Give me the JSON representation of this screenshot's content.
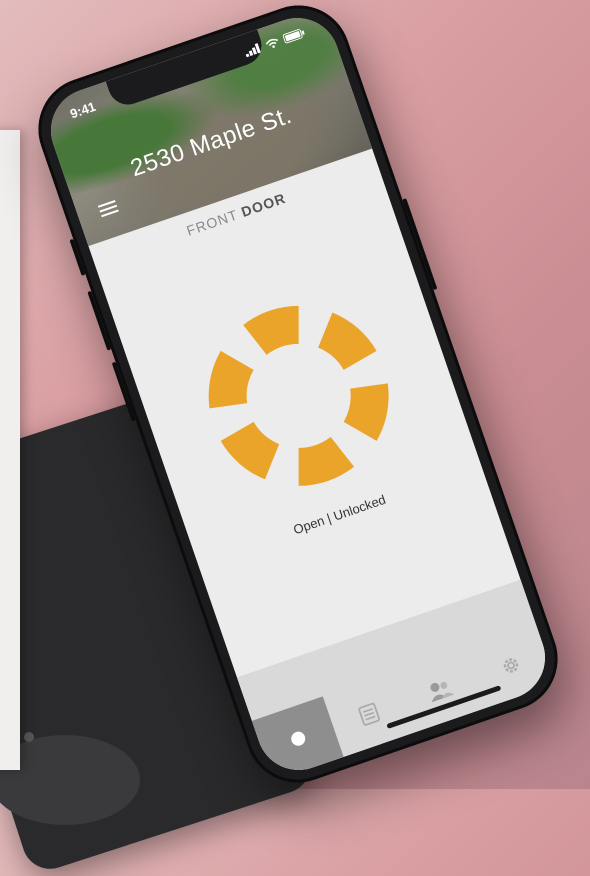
{
  "status_bar": {
    "time": "9:41",
    "signal_icon": "cellular-signal-icon",
    "wifi_icon": "wifi-icon",
    "battery_icon": "battery-icon"
  },
  "header": {
    "address": "2530 Maple St.",
    "menu_icon": "hamburger-menu-icon"
  },
  "door": {
    "title_prefix": "FRONT",
    "title_main": "DOOR"
  },
  "lock": {
    "status": "Open | Unlocked",
    "accent_color": "#EBA42A",
    "segments": 6
  },
  "tabbar": {
    "tabs": [
      {
        "name": "home",
        "icon": "dot-icon",
        "active": true
      },
      {
        "name": "history",
        "icon": "history-list-icon",
        "active": false
      },
      {
        "name": "users",
        "icon": "users-icon",
        "active": false
      },
      {
        "name": "settings",
        "icon": "gear-icon",
        "active": false
      }
    ]
  }
}
